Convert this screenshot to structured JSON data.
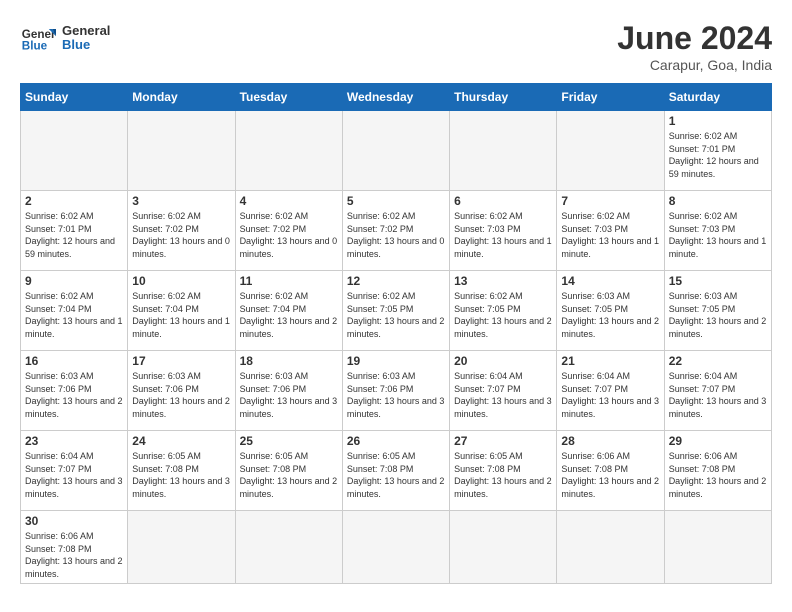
{
  "header": {
    "logo_general": "General",
    "logo_blue": "Blue",
    "title": "June 2024",
    "subtitle": "Carapur, Goa, India"
  },
  "days_of_week": [
    "Sunday",
    "Monday",
    "Tuesday",
    "Wednesday",
    "Thursday",
    "Friday",
    "Saturday"
  ],
  "weeks": [
    [
      {
        "num": "",
        "info": ""
      },
      {
        "num": "",
        "info": ""
      },
      {
        "num": "",
        "info": ""
      },
      {
        "num": "",
        "info": ""
      },
      {
        "num": "",
        "info": ""
      },
      {
        "num": "",
        "info": ""
      },
      {
        "num": "1",
        "info": "Sunrise: 6:02 AM\nSunset: 7:01 PM\nDaylight: 12 hours\nand 59 minutes."
      }
    ],
    [
      {
        "num": "2",
        "info": "Sunrise: 6:02 AM\nSunset: 7:01 PM\nDaylight: 12 hours\nand 59 minutes."
      },
      {
        "num": "3",
        "info": "Sunrise: 6:02 AM\nSunset: 7:02 PM\nDaylight: 13 hours\nand 0 minutes."
      },
      {
        "num": "4",
        "info": "Sunrise: 6:02 AM\nSunset: 7:02 PM\nDaylight: 13 hours\nand 0 minutes."
      },
      {
        "num": "5",
        "info": "Sunrise: 6:02 AM\nSunset: 7:02 PM\nDaylight: 13 hours\nand 0 minutes."
      },
      {
        "num": "6",
        "info": "Sunrise: 6:02 AM\nSunset: 7:03 PM\nDaylight: 13 hours\nand 1 minute."
      },
      {
        "num": "7",
        "info": "Sunrise: 6:02 AM\nSunset: 7:03 PM\nDaylight: 13 hours\nand 1 minute."
      },
      {
        "num": "8",
        "info": "Sunrise: 6:02 AM\nSunset: 7:03 PM\nDaylight: 13 hours\nand 1 minute."
      }
    ],
    [
      {
        "num": "9",
        "info": "Sunrise: 6:02 AM\nSunset: 7:04 PM\nDaylight: 13 hours\nand 1 minute."
      },
      {
        "num": "10",
        "info": "Sunrise: 6:02 AM\nSunset: 7:04 PM\nDaylight: 13 hours\nand 1 minute."
      },
      {
        "num": "11",
        "info": "Sunrise: 6:02 AM\nSunset: 7:04 PM\nDaylight: 13 hours\nand 2 minutes."
      },
      {
        "num": "12",
        "info": "Sunrise: 6:02 AM\nSunset: 7:05 PM\nDaylight: 13 hours\nand 2 minutes."
      },
      {
        "num": "13",
        "info": "Sunrise: 6:02 AM\nSunset: 7:05 PM\nDaylight: 13 hours\nand 2 minutes."
      },
      {
        "num": "14",
        "info": "Sunrise: 6:03 AM\nSunset: 7:05 PM\nDaylight: 13 hours\nand 2 minutes."
      },
      {
        "num": "15",
        "info": "Sunrise: 6:03 AM\nSunset: 7:05 PM\nDaylight: 13 hours\nand 2 minutes."
      }
    ],
    [
      {
        "num": "16",
        "info": "Sunrise: 6:03 AM\nSunset: 7:06 PM\nDaylight: 13 hours\nand 2 minutes."
      },
      {
        "num": "17",
        "info": "Sunrise: 6:03 AM\nSunset: 7:06 PM\nDaylight: 13 hours\nand 2 minutes."
      },
      {
        "num": "18",
        "info": "Sunrise: 6:03 AM\nSunset: 7:06 PM\nDaylight: 13 hours\nand 3 minutes."
      },
      {
        "num": "19",
        "info": "Sunrise: 6:03 AM\nSunset: 7:06 PM\nDaylight: 13 hours\nand 3 minutes."
      },
      {
        "num": "20",
        "info": "Sunrise: 6:04 AM\nSunset: 7:07 PM\nDaylight: 13 hours\nand 3 minutes."
      },
      {
        "num": "21",
        "info": "Sunrise: 6:04 AM\nSunset: 7:07 PM\nDaylight: 13 hours\nand 3 minutes."
      },
      {
        "num": "22",
        "info": "Sunrise: 6:04 AM\nSunset: 7:07 PM\nDaylight: 13 hours\nand 3 minutes."
      }
    ],
    [
      {
        "num": "23",
        "info": "Sunrise: 6:04 AM\nSunset: 7:07 PM\nDaylight: 13 hours\nand 3 minutes."
      },
      {
        "num": "24",
        "info": "Sunrise: 6:05 AM\nSunset: 7:08 PM\nDaylight: 13 hours\nand 3 minutes."
      },
      {
        "num": "25",
        "info": "Sunrise: 6:05 AM\nSunset: 7:08 PM\nDaylight: 13 hours\nand 2 minutes."
      },
      {
        "num": "26",
        "info": "Sunrise: 6:05 AM\nSunset: 7:08 PM\nDaylight: 13 hours\nand 2 minutes."
      },
      {
        "num": "27",
        "info": "Sunrise: 6:05 AM\nSunset: 7:08 PM\nDaylight: 13 hours\nand 2 minutes."
      },
      {
        "num": "28",
        "info": "Sunrise: 6:06 AM\nSunset: 7:08 PM\nDaylight: 13 hours\nand 2 minutes."
      },
      {
        "num": "29",
        "info": "Sunrise: 6:06 AM\nSunset: 7:08 PM\nDaylight: 13 hours\nand 2 minutes."
      }
    ],
    [
      {
        "num": "30",
        "info": "Sunrise: 6:06 AM\nSunset: 7:08 PM\nDaylight: 13 hours\nand 2 minutes."
      },
      {
        "num": "",
        "info": ""
      },
      {
        "num": "",
        "info": ""
      },
      {
        "num": "",
        "info": ""
      },
      {
        "num": "",
        "info": ""
      },
      {
        "num": "",
        "info": ""
      },
      {
        "num": "",
        "info": ""
      }
    ]
  ]
}
